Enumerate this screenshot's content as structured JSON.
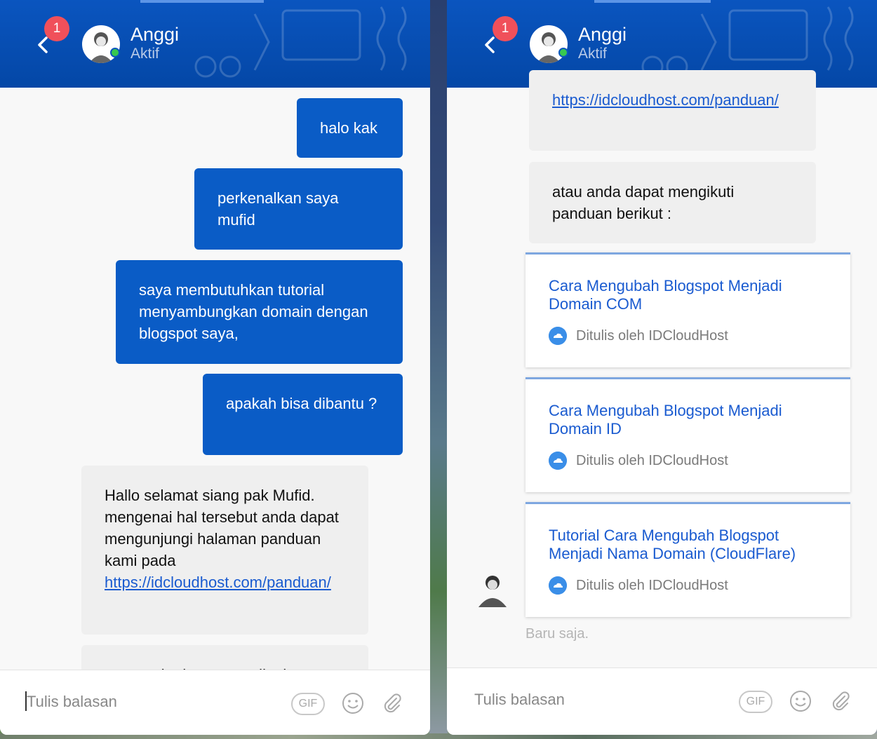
{
  "header": {
    "agent_name": "Anggi",
    "agent_status": "Aktif",
    "unread_badge": "1"
  },
  "left_chat": {
    "outgoing": [
      {
        "text": "halo kak"
      },
      {
        "text": "perkenalkan saya mufid"
      },
      {
        "text": "saya membutuhkan tutorial menyambungkan domain dengan blogspot saya,"
      },
      {
        "text": "apakah bisa dibantu ?"
      }
    ],
    "incoming": {
      "text": "Hallo selamat siang pak Mufid. mengenai hal tersebut anda dapat mengunjungi halaman panduan kami pada",
      "link": "https://idcloudhost.com/panduan/"
    },
    "clipped_text": "atau anda dapat mengikuti"
  },
  "right_chat": {
    "link_tail": "https://idcloudhost.com/panduan/",
    "incoming_text": "atau anda dapat mengikuti panduan berikut :",
    "cards": [
      {
        "title": "Cara Mengubah Blogspot Menjadi Domain COM",
        "author": "Ditulis oleh IDCloudHost"
      },
      {
        "title": "Cara Mengubah Blogspot Menjadi Domain ID",
        "author": "Ditulis oleh IDCloudHost"
      },
      {
        "title": "Tutorial Cara Mengubah Blogspot Menjadi Nama Domain (CloudFlare)",
        "author": "Ditulis oleh IDCloudHost"
      }
    ],
    "timestamp": "Baru saja."
  },
  "composer": {
    "placeholder": "Tulis balasan",
    "gif_label": "GIF"
  },
  "icons": {
    "back": "chevron-left-icon",
    "emoji": "smiley-icon",
    "attach": "paperclip-icon"
  },
  "colors": {
    "header": "#0a55bf",
    "outgoing_bubble": "#0a5cc6",
    "incoming_bubble": "#efefef",
    "badge": "#f0505a",
    "online": "#37c84f",
    "link": "#1a5bd0"
  }
}
